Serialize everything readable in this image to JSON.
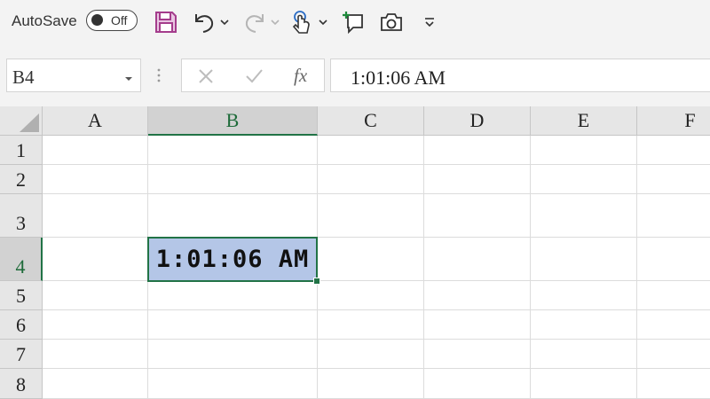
{
  "toolbar": {
    "autosave_label": "AutoSave",
    "autosave_state": "Off",
    "icons": [
      "save-icon",
      "undo-icon",
      "redo-icon",
      "touch-mode-icon",
      "new-comment-icon",
      "camera-icon",
      "customize-toolbar-icon"
    ]
  },
  "name_box": {
    "value": "B4"
  },
  "formula_bar": {
    "value": "1:01:06 AM",
    "fx_label": "fx"
  },
  "sheet": {
    "columns": [
      "A",
      "B",
      "C",
      "D",
      "E",
      "F"
    ],
    "rows": [
      "1",
      "2",
      "3",
      "4",
      "5",
      "6",
      "7",
      "8"
    ],
    "selected_column": "B",
    "selected_row": "4",
    "active_cell_value": "1:01:06 AM"
  },
  "colors": {
    "accent_green": "#217346",
    "selection_fill": "#b4c6e7",
    "save_icon": "#a43c8c"
  }
}
